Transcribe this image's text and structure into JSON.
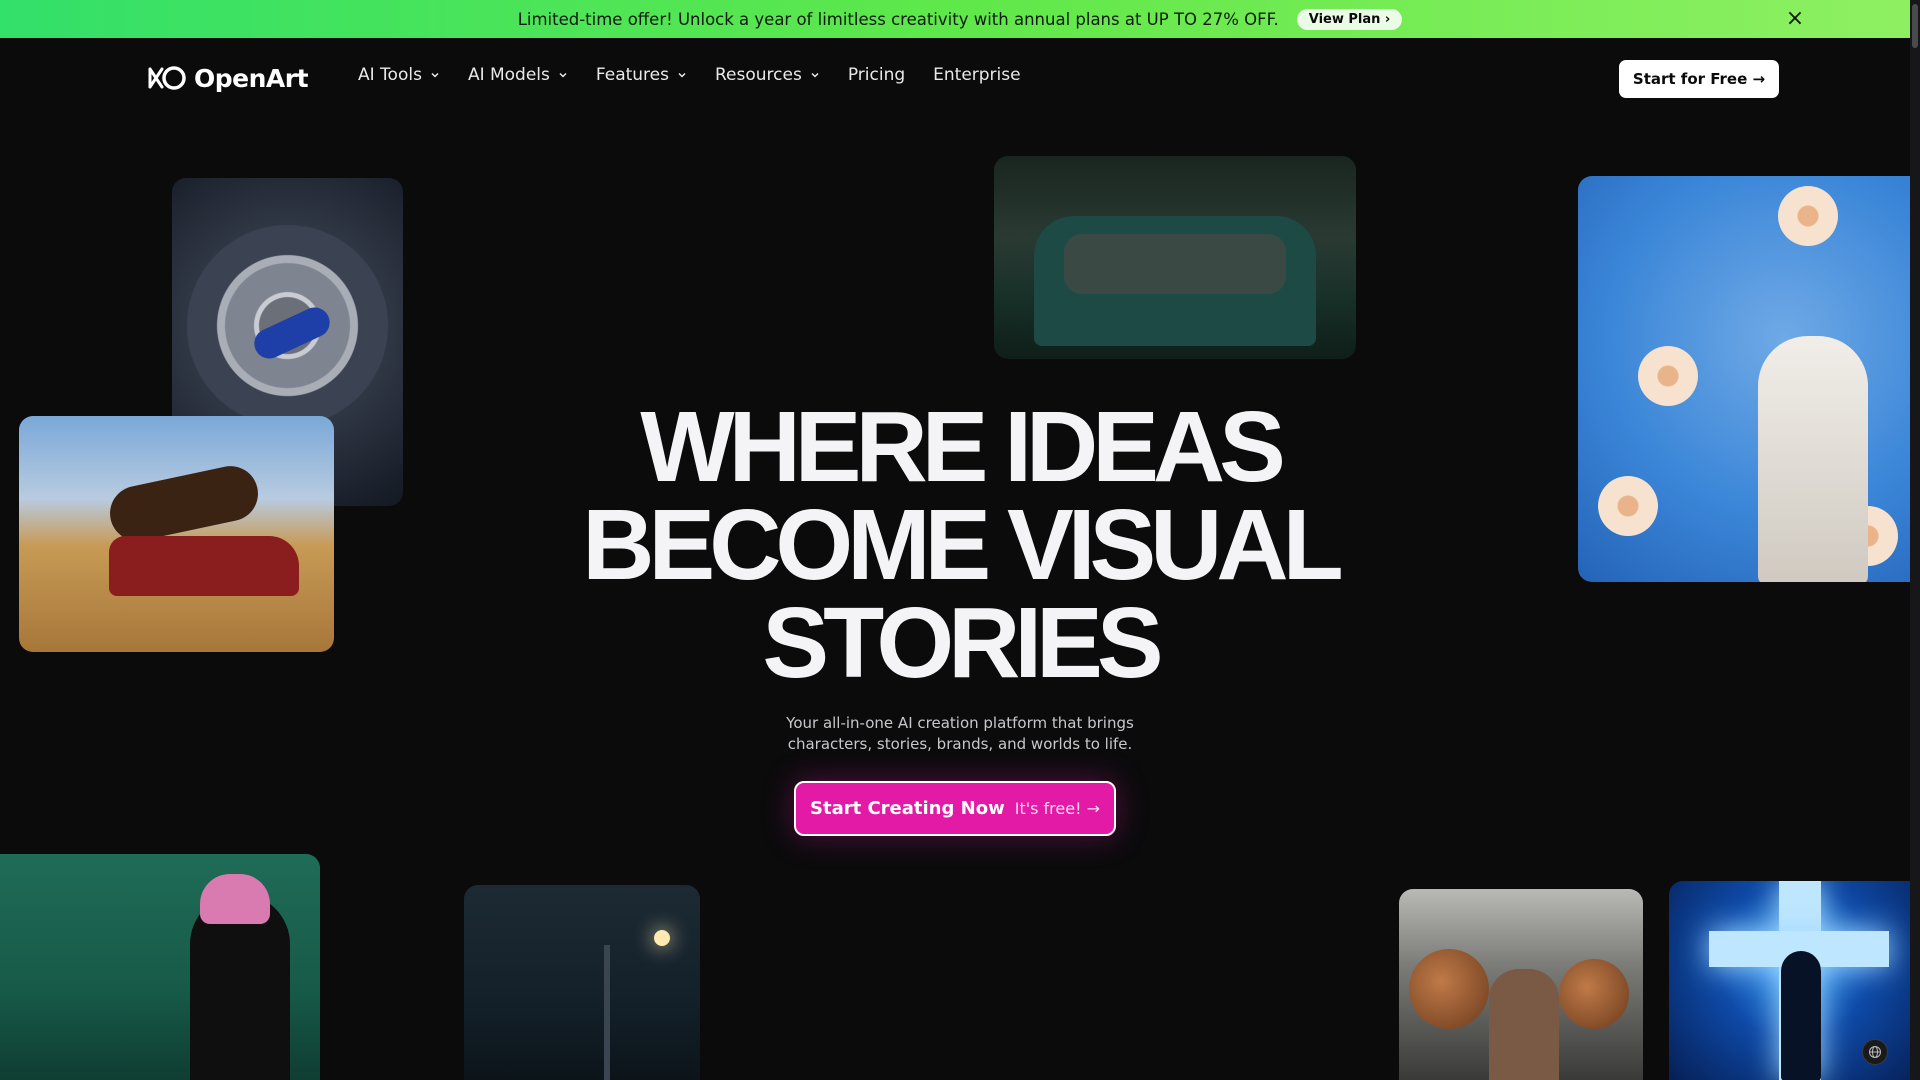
{
  "promo": {
    "text": "Limited-time offer! Unlock a year of limitless creativity with annual plans at UP TO 27% OFF.",
    "cta": "View Plan ›",
    "close_icon": "×"
  },
  "nav": {
    "logo_text": "OpenArt",
    "items": [
      {
        "label": "AI Tools",
        "has_dropdown": true
      },
      {
        "label": "AI Models",
        "has_dropdown": true
      },
      {
        "label": "Features",
        "has_dropdown": true
      },
      {
        "label": "Resources",
        "has_dropdown": true
      },
      {
        "label": "Pricing",
        "has_dropdown": false
      },
      {
        "label": "Enterprise",
        "has_dropdown": false
      }
    ],
    "start_free": "Start for Free →"
  },
  "hero": {
    "headline_line1": "WHERE IDEAS",
    "headline_line2": "BECOME VISUAL",
    "headline_line3": "STORIES",
    "subtitle": "Your all-in-one AI creation platform that brings characters, stories, brands, and worlds to life.",
    "cta_main": "Start Creating Now",
    "cta_note": "It's free! →"
  },
  "colors": {
    "promo_green": "#5fe84a",
    "cta_pink": "#e31aa6",
    "background": "#0b0b0c"
  },
  "icons": {
    "globe": "globe-icon",
    "close": "close-icon",
    "chevron": "chevron-down-icon"
  }
}
